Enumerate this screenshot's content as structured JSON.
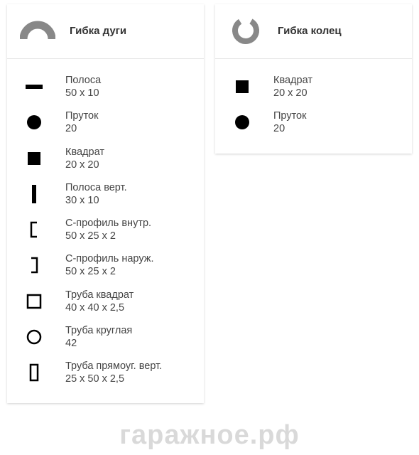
{
  "watermark": "гаражное.рф",
  "panels": [
    {
      "title": "Гибка дуги",
      "headerIcon": "arc-icon",
      "items": [
        {
          "icon": "strip-icon",
          "label": "Полоса",
          "dims": "50 x 10"
        },
        {
          "icon": "rod-icon",
          "label": "Пруток",
          "dims": "20"
        },
        {
          "icon": "square-filled-icon",
          "label": "Квадрат",
          "dims": "20 x 20"
        },
        {
          "icon": "strip-vert-icon",
          "label": "Полоса верт.",
          "dims": "30 x 10"
        },
        {
          "icon": "c-profile-in-icon",
          "label": "C-профиль внутр.",
          "dims": "50 x 25 x 2"
        },
        {
          "icon": "c-profile-out-icon",
          "label": "C-профиль наруж.",
          "dims": "50 x 25 x 2"
        },
        {
          "icon": "square-tube-icon",
          "label": "Труба квадрат",
          "dims": "40 x 40 x 2,5"
        },
        {
          "icon": "round-tube-icon",
          "label": "Труба круглая",
          "dims": "42"
        },
        {
          "icon": "rect-tube-vert-icon",
          "label": "Труба прямоуг. верт.",
          "dims": "25 x 50 x 2,5"
        }
      ]
    },
    {
      "title": "Гибка колец",
      "headerIcon": "ring-icon",
      "items": [
        {
          "icon": "square-filled-icon",
          "label": "Квадрат",
          "dims": "20 x 20"
        },
        {
          "icon": "rod-icon",
          "label": "Пруток",
          "dims": "20"
        }
      ]
    }
  ]
}
